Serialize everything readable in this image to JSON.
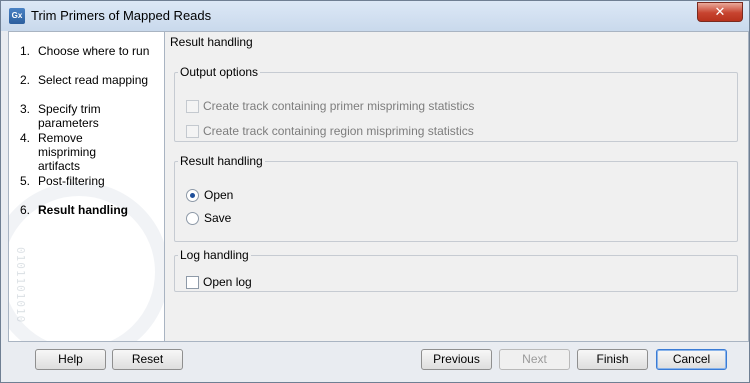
{
  "window": {
    "title": "Trim Primers of Mapped Reads",
    "app_icon": "Gx",
    "close_label": "✕"
  },
  "steps": [
    {
      "num": "1.",
      "label": "Choose where to run",
      "active": false
    },
    {
      "num": "2.",
      "label": "Select read mapping",
      "active": false
    },
    {
      "num": "3.",
      "label": "Specify trim parameters",
      "active": false
    },
    {
      "num": "4.",
      "label": "Remove mispriming artifacts",
      "active": false
    },
    {
      "num": "5.",
      "label": "Post-filtering",
      "active": false
    },
    {
      "num": "6.",
      "label": "Result handling",
      "active": true
    }
  ],
  "content": {
    "title": "Result handling",
    "output_options": {
      "legend": "Output options",
      "items": [
        {
          "label": "Create track containing primer mispriming statistics",
          "checked": false,
          "enabled": false
        },
        {
          "label": "Create track containing region mispriming statistics",
          "checked": false,
          "enabled": false
        }
      ]
    },
    "result_handling": {
      "legend": "Result handling",
      "options": [
        {
          "label": "Open",
          "selected": true
        },
        {
          "label": "Save",
          "selected": false
        }
      ]
    },
    "log_handling": {
      "legend": "Log handling",
      "open_log": {
        "label": "Open log",
        "checked": false
      }
    }
  },
  "buttons": {
    "help": "Help",
    "reset": "Reset",
    "previous": "Previous",
    "next": "Next",
    "finish": "Finish",
    "cancel": "Cancel"
  }
}
